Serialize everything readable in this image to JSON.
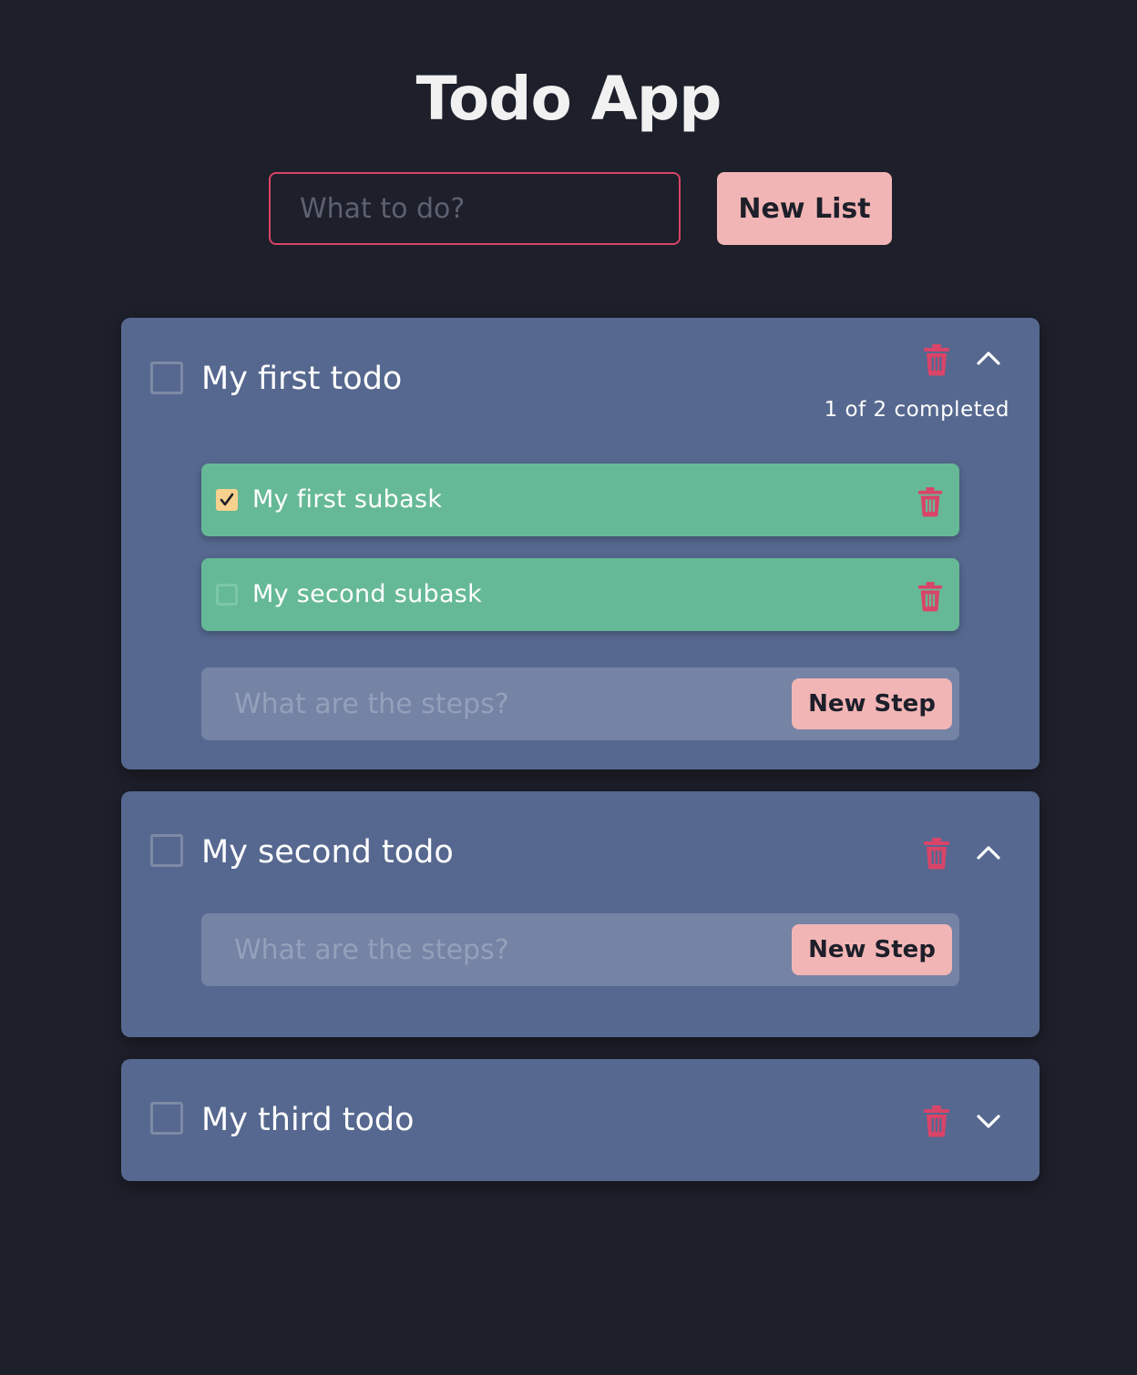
{
  "app": {
    "title": "Todo App",
    "main_input_placeholder": "What to do?",
    "new_list_label": "New List"
  },
  "colors": {
    "background": "#1d1f2a",
    "card": "#56688f",
    "subtask": "#66b996",
    "accent_button": "#f2b5b5",
    "danger": "#d94468",
    "checked_box": "#f7d18d"
  },
  "todos": [
    {
      "title": "My first todo",
      "checked": false,
      "expanded": true,
      "progress_text": "1 of 2 completed",
      "subtasks": [
        {
          "label": "My first subask",
          "checked": true
        },
        {
          "label": "My second subask",
          "checked": false
        }
      ],
      "step_placeholder": "What are the steps?",
      "step_button_label": "New Step"
    },
    {
      "title": "My second todo",
      "checked": false,
      "expanded": true,
      "step_placeholder": "What are the steps?",
      "step_button_label": "New Step"
    },
    {
      "title": "My third todo",
      "checked": false,
      "expanded": false
    }
  ]
}
